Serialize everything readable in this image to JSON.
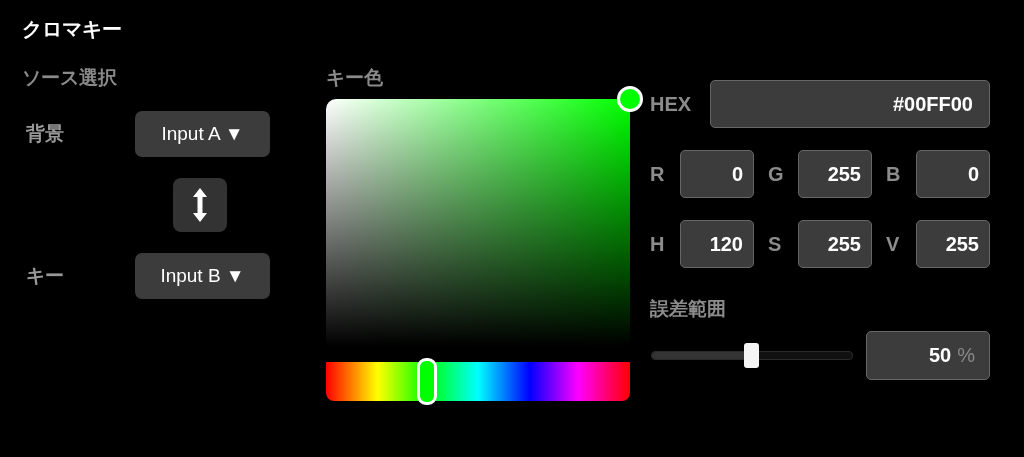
{
  "title": "クロマキー",
  "source": {
    "heading": "ソース選択",
    "rows": [
      {
        "label": "背景",
        "value": "Input A",
        "arrow": "▼"
      },
      {
        "label": "キー",
        "value": "Input B",
        "arrow": "▼"
      }
    ]
  },
  "key_color": {
    "heading": "キー色",
    "hue": {
      "level": 0.333
    }
  },
  "hex": {
    "label": "HEX",
    "value": "#00FF00"
  },
  "rgb": [
    {
      "label": "R",
      "value": "0"
    },
    {
      "label": "G",
      "value": "255"
    },
    {
      "label": "B",
      "value": "0"
    }
  ],
  "hsv": [
    {
      "label": "H",
      "value": "120"
    },
    {
      "label": "S",
      "value": "255"
    },
    {
      "label": "V",
      "value": "255"
    }
  ],
  "tolerance": {
    "label": "誤差範囲",
    "level": 0.5,
    "value": "50",
    "unit": "%"
  }
}
